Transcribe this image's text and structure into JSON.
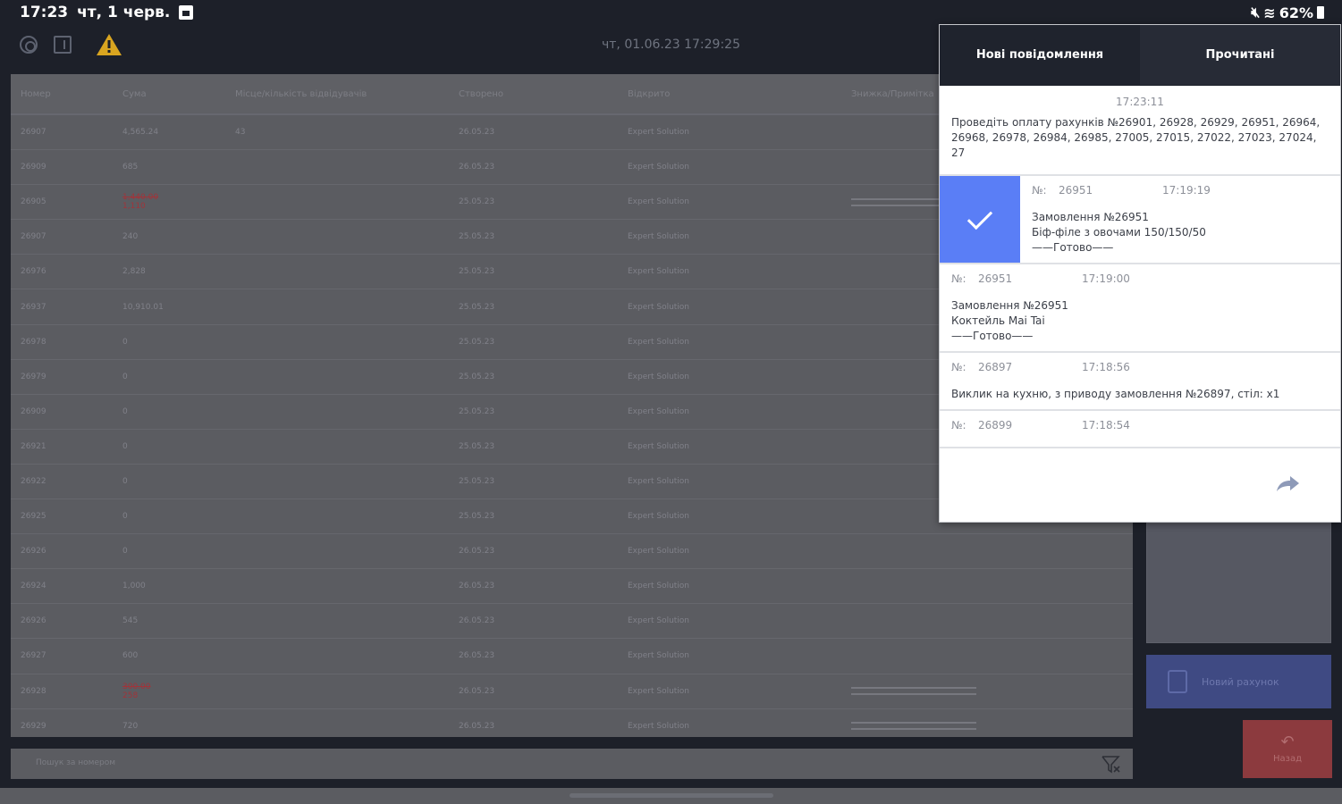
{
  "status_bar": {
    "time": "17:23",
    "date": "чт, 1 черв.",
    "battery": "62%"
  },
  "toolbar": {
    "datetime": "чт, 01.06.23 17:29:25"
  },
  "table": {
    "headers": [
      "Номер",
      "Сума",
      "Місце/кількість відвідувачів",
      "Створено",
      "Відкрито",
      "Знижка/Примітка"
    ],
    "rows": [
      {
        "num": "26907",
        "sum": "4,565.24",
        "guests": "43",
        "created": "26.05.23",
        "opened": "Expert Solution",
        "note": ""
      },
      {
        "num": "26909",
        "sum": "685",
        "guests": "",
        "created": "26.05.23",
        "opened": "Expert Solution",
        "note": ""
      },
      {
        "num": "26905",
        "sum_old": "1,440.00",
        "sum": "1,110",
        "guests": "",
        "created": "25.05.23",
        "opened": "Expert Solution",
        "note": "lines"
      },
      {
        "num": "26907",
        "sum": "240",
        "guests": "",
        "created": "25.05.23",
        "opened": "Expert Solution",
        "note": ""
      },
      {
        "num": "26976",
        "sum": "2,828",
        "guests": "",
        "created": "25.05.23",
        "opened": "Expert Solution",
        "note": ""
      },
      {
        "num": "26937",
        "sum": "10,910.01",
        "guests": "",
        "created": "25.05.23",
        "opened": "Expert Solution",
        "note": ""
      },
      {
        "num": "26978",
        "sum": "0",
        "guests": "",
        "created": "25.05.23",
        "opened": "Expert Solution",
        "note": ""
      },
      {
        "num": "26979",
        "sum": "0",
        "guests": "",
        "created": "25.05.23",
        "opened": "Expert Solution",
        "note": ""
      },
      {
        "num": "26909",
        "sum": "0",
        "guests": "",
        "created": "25.05.23",
        "opened": "Expert Solution",
        "note": ""
      },
      {
        "num": "26921",
        "sum": "0",
        "guests": "",
        "created": "25.05.23",
        "opened": "Expert Solution",
        "note": ""
      },
      {
        "num": "26922",
        "sum": "0",
        "guests": "",
        "created": "25.05.23",
        "opened": "Expert Solution",
        "note": ""
      },
      {
        "num": "26925",
        "sum": "0",
        "guests": "",
        "created": "25.05.23",
        "opened": "Expert Solution",
        "note": ""
      },
      {
        "num": "26926",
        "sum": "0",
        "guests": "",
        "created": "26.05.23",
        "opened": "Expert Solution",
        "note": ""
      },
      {
        "num": "26924",
        "sum": "1,000",
        "guests": "",
        "created": "26.05.23",
        "opened": "Expert Solution",
        "note": ""
      },
      {
        "num": "26926",
        "sum": "545",
        "guests": "",
        "created": "26.05.23",
        "opened": "Expert Solution",
        "note": ""
      },
      {
        "num": "26927",
        "sum": "600",
        "guests": "",
        "created": "26.05.23",
        "opened": "Expert Solution",
        "note": ""
      },
      {
        "num": "26928",
        "sum_old": "300.00",
        "sum": "258",
        "guests": "",
        "created": "26.05.23",
        "opened": "Expert Solution",
        "note": "lines"
      },
      {
        "num": "26929",
        "sum": "720",
        "guests": "",
        "created": "26.05.23",
        "opened": "Expert Solution",
        "note": "lines"
      }
    ]
  },
  "search": {
    "placeholder": "Пошук за номером"
  },
  "right_panel": {
    "new_bill_label": "Новий рахунок",
    "back_label": "Назад"
  },
  "popup": {
    "tab_new": "Нові повідомлення",
    "tab_read": "Прочитані",
    "messages": [
      {
        "time": "17:23:11",
        "text": "Проведіть оплату рахунків №26901, 26928, 26929, 26951, 26964, 26968, 26978, 26984, 26985, 27005, 27015, 27022, 27023, 27024, 27"
      },
      {
        "nr_label": "№:",
        "nr": "26951",
        "time": "17:19:19",
        "line1": "Замовлення №26951",
        "line2": "Біф-філе з овочами 150/150/50",
        "line3": "——Готово——"
      },
      {
        "nr_label": "№:",
        "nr": "26951",
        "time": "17:19:00",
        "line1": "Замовлення №26951",
        "line2": "Коктейль Mai Tai",
        "line3": "——Готово——"
      },
      {
        "nr_label": "№:",
        "nr": "26897",
        "time": "17:18:56",
        "line1": "Виклик на кухню, з приводу замовлення №26897, стіл: х1"
      },
      {
        "nr_label": "№:",
        "nr": "26899",
        "time": "17:18:54"
      }
    ]
  },
  "colors": {
    "accent_check": "#5a7ef6",
    "popup_header": "#272b36",
    "background": "#1d2029"
  }
}
